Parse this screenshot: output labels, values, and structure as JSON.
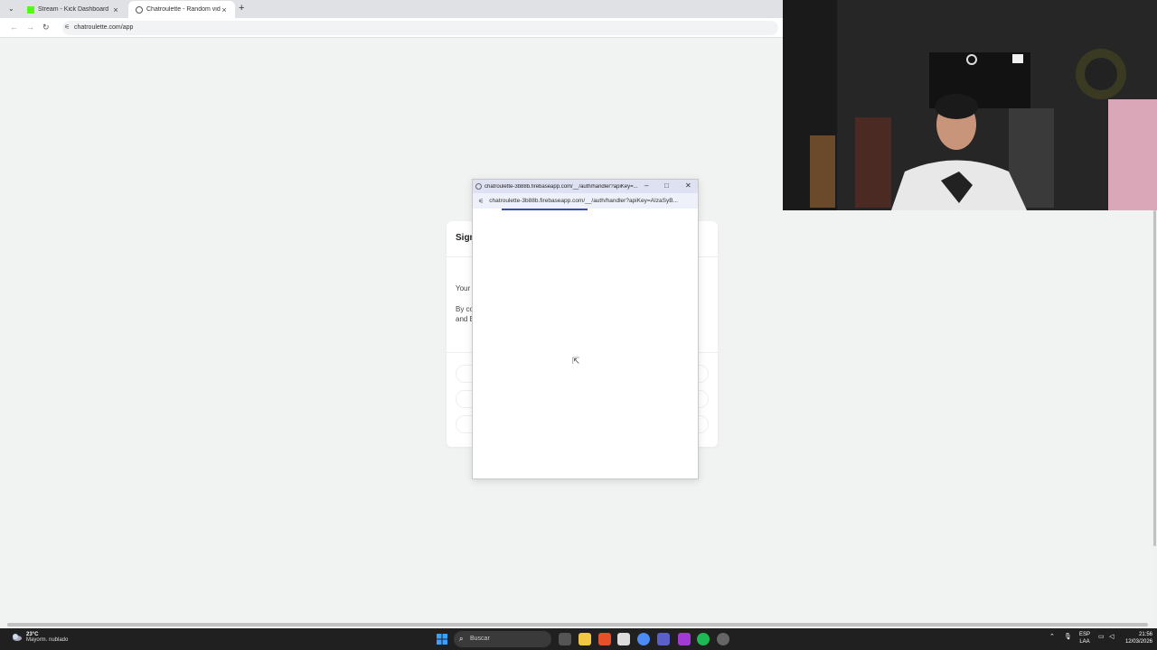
{
  "browser": {
    "tabs": [
      {
        "label": "Stream - Kick Dashboard",
        "active": false
      },
      {
        "label": "Chatroulette - Random video c",
        "active": true
      }
    ],
    "close_glyph": "×",
    "new_tab_glyph": "+",
    "url": "chatroulette.com/app"
  },
  "card": {
    "title": "Sign",
    "line1": "Your",
    "line2": "By co",
    "line3": "and E"
  },
  "popup": {
    "title": "chatroulette-3b88b.firebaseapp.com/__/auth/handler?apiKey=...",
    "url": "chatroulette-3b88b.firebaseapp.com/__/auth/handler?apiKey=AIzaSyB...",
    "loading_progress": 0.38
  },
  "taskbar": {
    "temp": "23°C",
    "weather": "Mayorm. nublado",
    "search_placeholder": "Buscar",
    "lang1": "ESP",
    "lang2": "LAA",
    "time": "21:56",
    "date": "12/03/2026"
  },
  "colors": {
    "page_bg": "#f1f3f2",
    "popup_accent": "#3c4aa8",
    "kick_green": "#53fc18",
    "taskbar_bg": "#202020"
  }
}
